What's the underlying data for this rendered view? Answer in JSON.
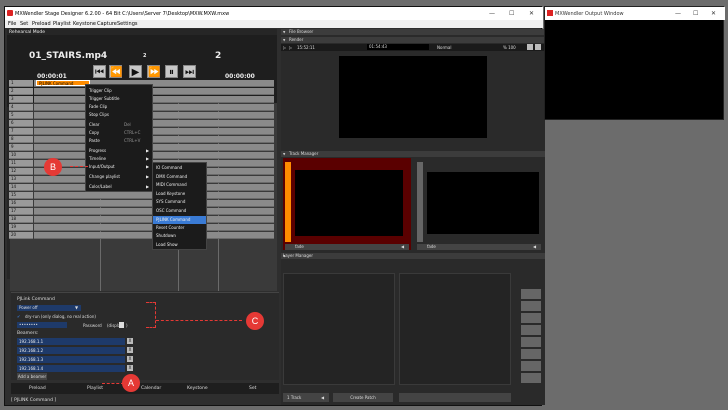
{
  "window": {
    "title": "MXWendler Stage Designer 6.2.00 - 64 Bit C:\\Users\\Server 7\\Desktop\\MXW.MXW.mxw",
    "minimize": "—",
    "maximize": "☐",
    "close": "✕"
  },
  "menu": [
    "File",
    "Set",
    "Preload",
    "Playlist",
    "Keystone",
    "Capture",
    "Settings"
  ],
  "left": {
    "mode_label": "Rehearsal Mode",
    "clip_name": "01_STAIRS.mp4",
    "small_num": "2",
    "big_num": "2",
    "time_left": "00:00:01",
    "time_right": "00:00:00",
    "transport": [
      "⏮",
      "⏪",
      "▶",
      "⏩",
      "⏸",
      "⏭"
    ],
    "row_numbers": [
      "1",
      "2",
      "3",
      "4",
      "5",
      "6",
      "7",
      "8",
      "9",
      "10",
      "11",
      "12",
      "13",
      "14",
      "15",
      "16",
      "17",
      "18",
      "19",
      "20"
    ],
    "clip_label": "PJLINK Command"
  },
  "context_menu": {
    "items": [
      {
        "label": "Trigger Clip",
        "shortcut": "",
        "arrow": ""
      },
      {
        "label": "Trigger Subtitle",
        "shortcut": "",
        "arrow": ""
      },
      {
        "label": "Fade Clip",
        "shortcut": "",
        "arrow": ""
      },
      {
        "label": "Stop Clips",
        "shortcut": "",
        "arrow": ""
      },
      {
        "label": "Clear",
        "shortcut": "Del",
        "arrow": ""
      },
      {
        "label": "Copy",
        "shortcut": "CTRL+C",
        "arrow": ""
      },
      {
        "label": "Paste",
        "shortcut": "CTRL+V",
        "arrow": ""
      },
      {
        "label": "Progress",
        "shortcut": "",
        "arrow": "▶"
      },
      {
        "label": "Timeline",
        "shortcut": "",
        "arrow": "▶"
      },
      {
        "label": "Input/Output",
        "shortcut": "",
        "arrow": "▶"
      },
      {
        "label": "Change playlist",
        "shortcut": "",
        "arrow": "▶"
      },
      {
        "label": "Color/Label",
        "shortcut": "",
        "arrow": "▶"
      }
    ]
  },
  "submenu": {
    "items": [
      "IO Command",
      "DMX Command",
      "MIDI Command",
      "Load Keystone",
      "SYS Command",
      "OSC Command",
      "PJLINK Command",
      "Reset Counter",
      "Shutdown",
      "Load Show"
    ],
    "selected_index": 6
  },
  "pjlink": {
    "title": "PJLink Command",
    "dropdown_value": "Power off",
    "dry_run_label": "dry-run (only dialog, no real action)",
    "password_mask": "••••••••",
    "password_label": "Password",
    "display_label": "(display",
    "display_suffix": ")",
    "beamers_label": "Beamers:",
    "beamers": [
      "192.168.1.1",
      "192.168.1.2",
      "192.168.1.3",
      "192.168.1.4"
    ],
    "remove_label": "X",
    "add_button": "Add a beamer"
  },
  "bottom_tabs": [
    "Preload",
    "Playlist",
    "Calendar",
    "Keystone",
    "Set"
  ],
  "status": "[ PJLINK Command ]",
  "callouts": {
    "a": "A",
    "b": "B",
    "c": "C"
  },
  "right": {
    "file_browser": "File Browser",
    "render": "Render",
    "render_time_left": "15:52:11",
    "render_time_mid": "01:54:43",
    "render_mode": "Normal",
    "render_zoom": "% 100",
    "track_manager": "Track Manager",
    "track_fade": "fade",
    "layer_manager": "Layer Manager",
    "track_btn": "1 Track",
    "create_patch": "Create Patch"
  },
  "output": {
    "title": "MXWendler Output Window",
    "minimize": "—",
    "maximize": "☐",
    "close": "✕"
  },
  "colors": {
    "accent": "#3a7bd5",
    "callout": "#e53935",
    "clip_orange": "#ff8c00",
    "track_red": "#5a0000"
  }
}
